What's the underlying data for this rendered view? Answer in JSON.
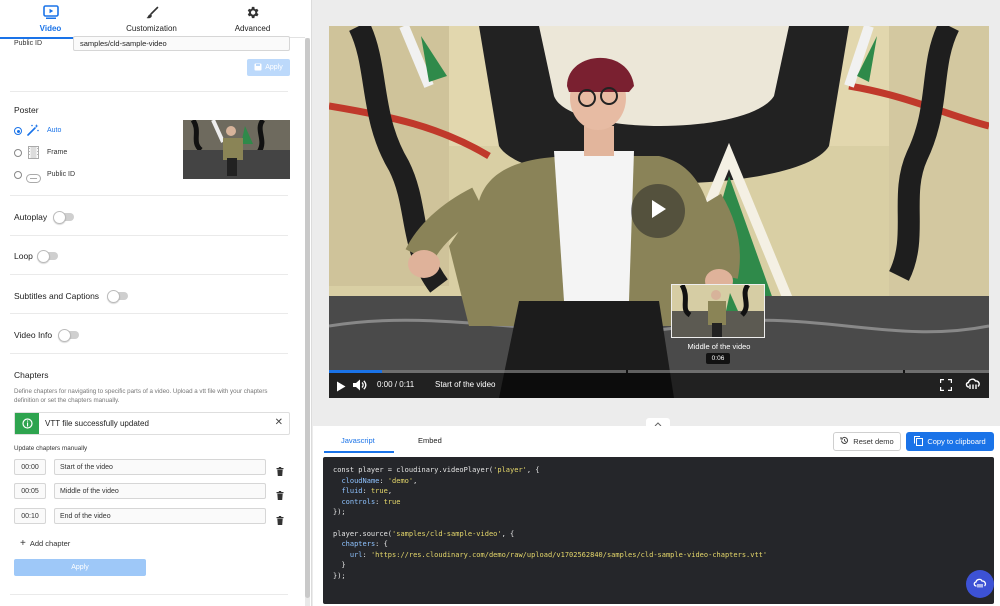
{
  "tabs": [
    {
      "label": "Video",
      "icon": "video-icon",
      "active": true
    },
    {
      "label": "Customization",
      "icon": "brush-icon",
      "active": false
    },
    {
      "label": "Advanced",
      "icon": "gear-icon",
      "active": false
    }
  ],
  "public_id": {
    "label": "Public ID",
    "value": "samples/cld-sample-video",
    "apply_label": "Apply"
  },
  "poster": {
    "title": "Poster",
    "options": [
      {
        "label": "Auto",
        "icon": "magic-wand-icon",
        "selected": true
      },
      {
        "label": "Frame",
        "icon": "film-frame-icon",
        "selected": false
      },
      {
        "label": "Public ID",
        "icon": "link-icon",
        "selected": false
      }
    ]
  },
  "toggles": [
    {
      "label": "Autoplay",
      "on": false
    },
    {
      "label": "Loop",
      "on": false
    },
    {
      "label": "Subtitles and Captions",
      "on": false
    },
    {
      "label": "Video Info",
      "on": false
    }
  ],
  "chapters": {
    "title": "Chapters",
    "description": "Define chapters for navigating to specific parts of a video. Upload a vtt file with your chapters definition or set the chapters manually.",
    "alert": "VTT file successfully updated",
    "manual_label": "Update chapters manually",
    "rows": [
      {
        "time": "00:00",
        "name": "Start of the video"
      },
      {
        "time": "00:05",
        "name": "Middle of the video"
      },
      {
        "time": "00:10",
        "name": "End of the video"
      }
    ],
    "add_label": "Add chapter",
    "apply_label": "Apply"
  },
  "player": {
    "time_current": "0:00",
    "time_total": "0:11",
    "chapter": "Start of the video",
    "preview_title": "Middle of the video",
    "preview_time": "0:06",
    "progress": 0.08,
    "chapter_marks": [
      0.45,
      0.87
    ],
    "colors": {
      "accent": "#1a73e8"
    }
  },
  "code_panel": {
    "tabs": [
      {
        "label": "Javascript",
        "active": true
      },
      {
        "label": "Embed",
        "active": false
      }
    ],
    "reset_label": "Reset demo",
    "copy_label": "Copy to clipboard",
    "lines": [
      "const player = cloudinary.videoPlayer('player', {",
      "  cloudName: 'demo',",
      "  fluid: true,",
      "  controls: true",
      "});",
      "",
      "player.source('samples/cld-sample-video', {",
      "  chapters: {",
      "    url: 'https://res.cloudinary.com/demo/raw/upload/v1702562840/samples/cld-sample-video-chapters.vtt'",
      "  }",
      "});"
    ]
  }
}
